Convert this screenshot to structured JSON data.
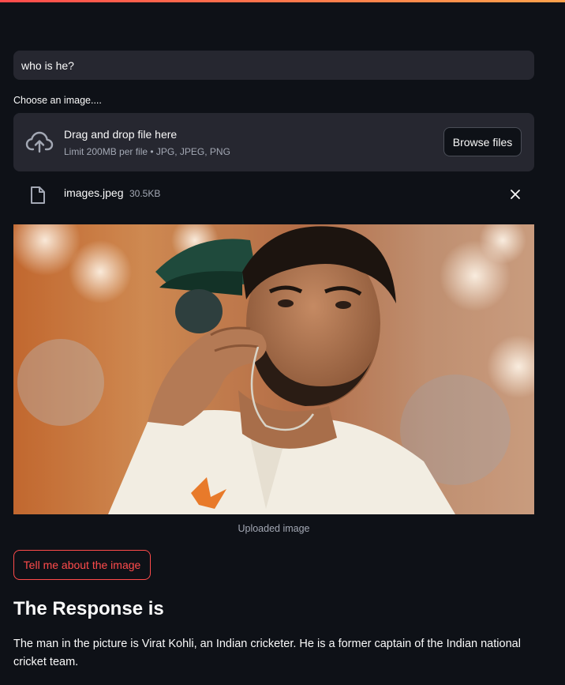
{
  "prompt": {
    "value": "who is he?"
  },
  "uploader": {
    "label": "Choose an image....",
    "drop_title": "Drag and drop file here",
    "drop_subtitle": "Limit 200MB per file • JPG, JPEG, PNG",
    "browse_label": "Browse files"
  },
  "file": {
    "name": "images.jpeg",
    "size": "30.5KB"
  },
  "image": {
    "caption": "Uploaded image"
  },
  "action": {
    "button_label": "Tell me about the image"
  },
  "response": {
    "heading": "The Response is",
    "text": "The man in the picture is Virat Kohli, an Indian cricketer. He is a former captain of the Indian national cricket team."
  },
  "colors": {
    "background": "#0e1117",
    "surface": "#262730",
    "accent": "#ff4b4b",
    "muted_text": "#a3a8b4"
  }
}
